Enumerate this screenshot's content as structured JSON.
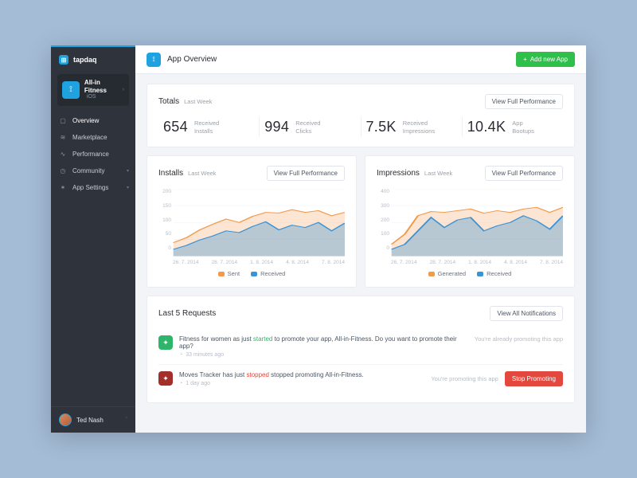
{
  "brand": {
    "name": "tapdaq",
    "logo_glyph": "⊞"
  },
  "app": {
    "name": "All-in Fitness",
    "platform": "iOS",
    "icon_glyph": "⟟"
  },
  "nav": {
    "items": [
      {
        "label": "Overview",
        "icon": "▢",
        "active": true
      },
      {
        "label": "Marketplace",
        "icon": "≋"
      },
      {
        "label": "Performance",
        "icon": "∿"
      },
      {
        "label": "Community",
        "icon": "◷",
        "expandable": true
      },
      {
        "label": "App Settings",
        "icon": "✶",
        "expandable": true
      }
    ]
  },
  "user": {
    "name": "Ted Nash"
  },
  "header": {
    "title": "App Overview",
    "icon_glyph": "⟟",
    "add_button": "Add new App"
  },
  "buttons": {
    "view_full_performance": "View Full Performance",
    "view_all_notifications": "View All Notifications",
    "stop_promoting": "Stop Promoting"
  },
  "totals": {
    "title": "Totals",
    "period": "Last Week",
    "stats": [
      {
        "value": "654",
        "label1": "Received",
        "label2": "Installs"
      },
      {
        "value": "994",
        "label1": "Received",
        "label2": "Clicks"
      },
      {
        "value": "7.5K",
        "label1": "Received",
        "label2": "Impressions"
      },
      {
        "value": "10.4K",
        "label1": "App",
        "label2": "Bootups"
      }
    ]
  },
  "chart_data": [
    {
      "type": "area",
      "title": "Installs",
      "period": "Last Week",
      "ylabel": "",
      "xlabel": "",
      "ylim": [
        0,
        200
      ],
      "yticks": [
        0,
        50,
        100,
        150,
        200
      ],
      "categories": [
        "26. 7. 2014",
        "28. 7. 2014",
        "1. 8. 2014",
        "4. 8. 2014",
        "7. 8. 2014"
      ],
      "series": [
        {
          "name": "Sent",
          "color": "#f2994a",
          "values": [
            40,
            55,
            78,
            95,
            110,
            100,
            118,
            130,
            128,
            138,
            130,
            135,
            120,
            130
          ]
        },
        {
          "name": "Received",
          "color": "#3a93d6",
          "values": [
            20,
            32,
            48,
            60,
            75,
            70,
            88,
            102,
            78,
            92,
            85,
            100,
            75,
            98
          ]
        }
      ]
    },
    {
      "type": "area",
      "title": "Impressions",
      "period": "Last Week",
      "ylabel": "",
      "xlabel": "",
      "ylim": [
        0,
        400
      ],
      "yticks": [
        0,
        100,
        200,
        300,
        400
      ],
      "categories": [
        "26. 7. 2014",
        "28. 7. 2014",
        "1. 8. 2014",
        "4. 8. 2014",
        "7. 8. 2014"
      ],
      "series": [
        {
          "name": "Generated",
          "color": "#f2994a",
          "values": [
            70,
            130,
            240,
            265,
            260,
            270,
            280,
            255,
            270,
            260,
            280,
            290,
            260,
            290
          ]
        },
        {
          "name": "Received",
          "color": "#3a93d6",
          "values": [
            40,
            70,
            150,
            230,
            170,
            215,
            230,
            150,
            180,
            200,
            240,
            210,
            160,
            240
          ]
        }
      ]
    }
  ],
  "requests": {
    "title": "Last 5 Requests",
    "items": [
      {
        "icon_color": "green",
        "pre": "Fitness for women as just ",
        "hl": "started",
        "hl_class": "green",
        "post": " to promote your app, All-in-Fitness. Do you want to promote their app?",
        "time": "33 minutes ago",
        "aside": "You're already promoting this app"
      },
      {
        "icon_color": "red",
        "pre": "Moves Tracker has just ",
        "hl": "stopped",
        "hl_class": "red",
        "post": " stopped promoting All-in-Fitness.",
        "time": "1 day ago",
        "aside": "You're promoting this app",
        "action": "stop"
      }
    ]
  },
  "colors": {
    "orange": "#f2994a",
    "blue": "#3a93d6"
  }
}
